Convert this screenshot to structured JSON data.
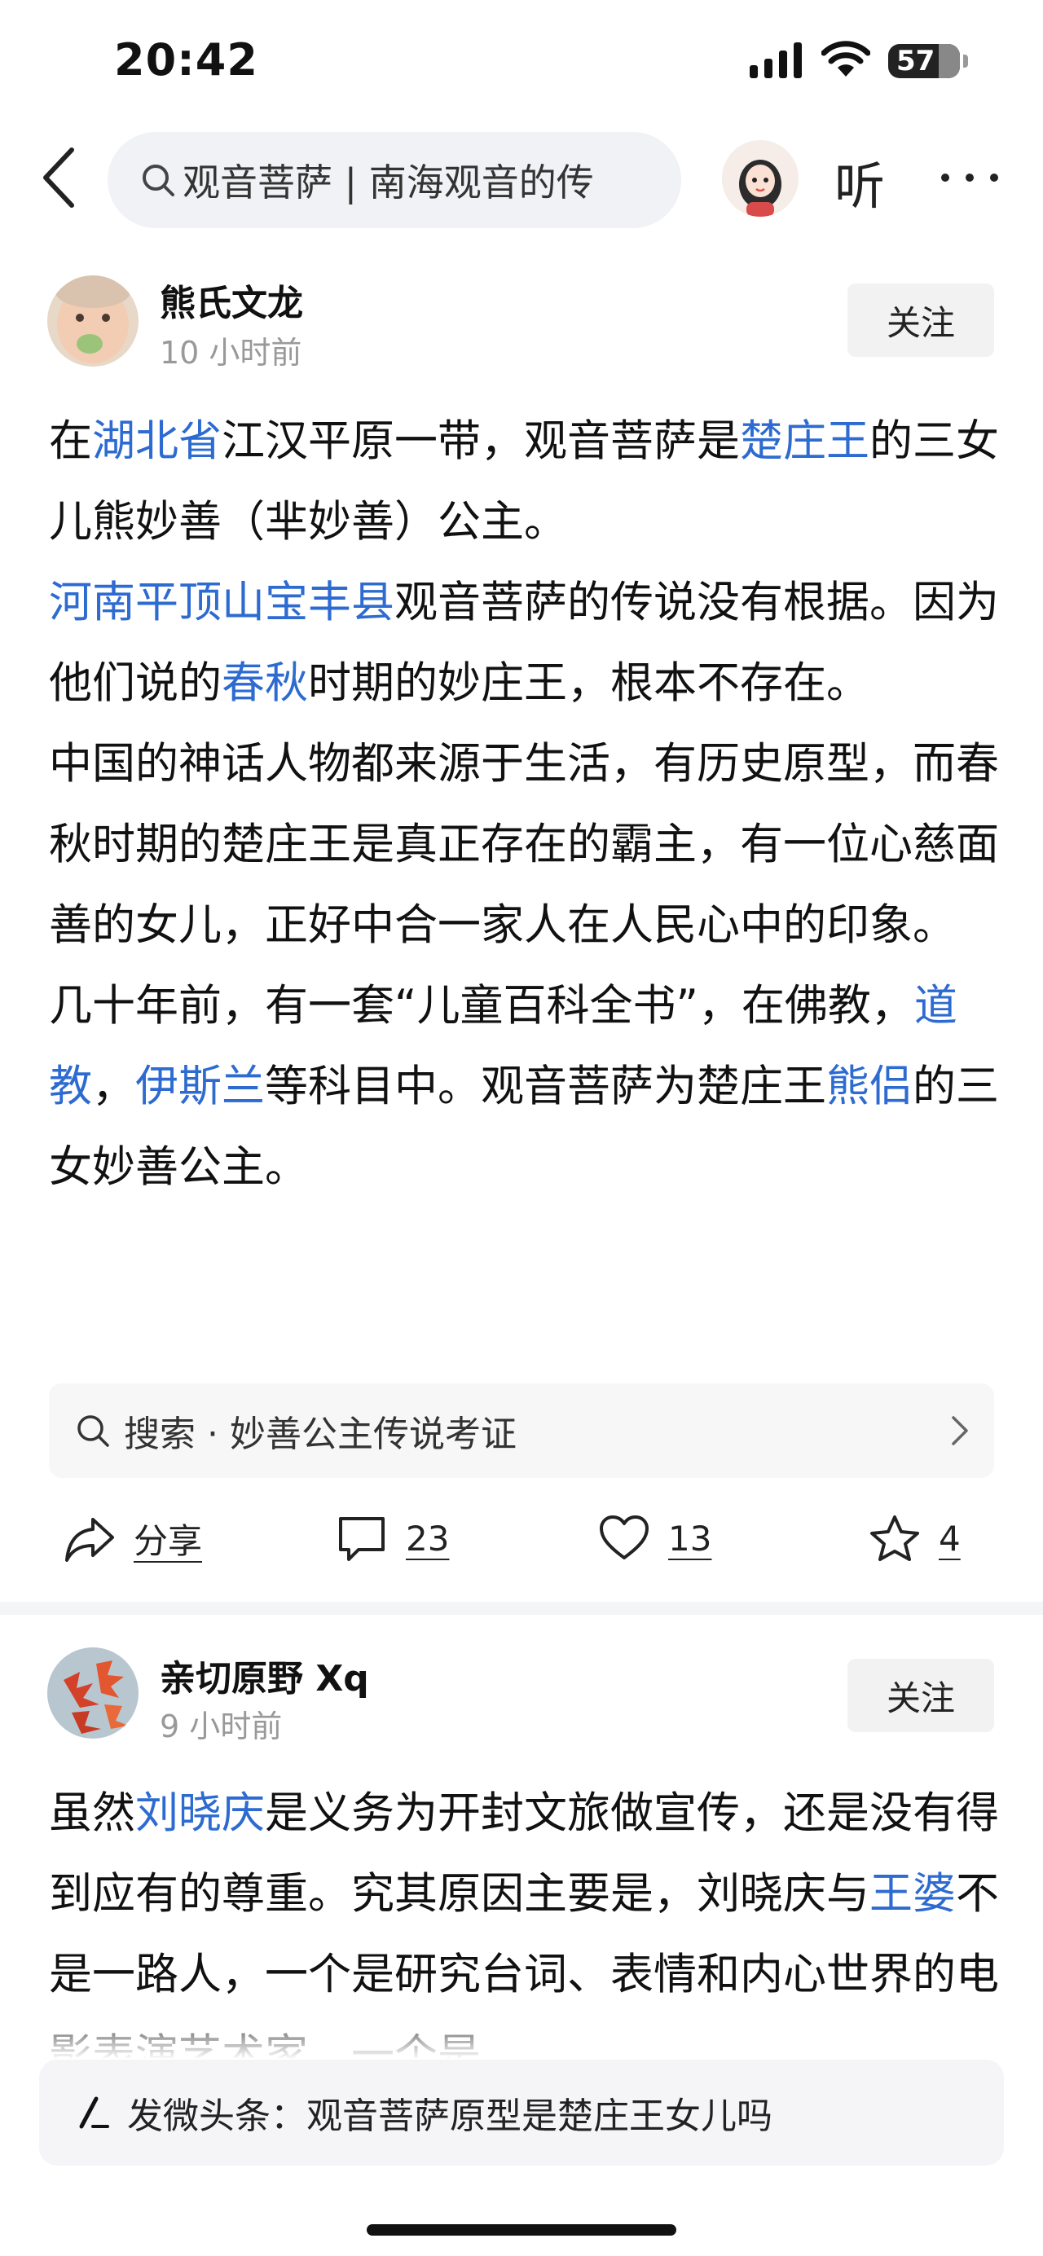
{
  "status_bar": {
    "time": "20:42",
    "battery": "57"
  },
  "nav": {
    "search_text": "观音菩萨 | 南海观音的传",
    "listen_label": "听"
  },
  "posts": [
    {
      "author": "熊氏文龙",
      "time": "10 小时前",
      "follow_label": "关注",
      "paragraphs": [
        [
          {
            "t": "在"
          },
          {
            "t": "湖北省",
            "link": true
          },
          {
            "t": "江汉平原一带，观音菩萨是"
          },
          {
            "t": "楚庄王",
            "link": true
          },
          {
            "t": "的三女儿熊妙善（芈妙善）公主。"
          }
        ],
        [
          {
            "t": "河南平顶山宝丰县",
            "link": true
          },
          {
            "t": "观音菩萨的传说没有根据。因为他们说的"
          },
          {
            "t": "春秋",
            "link": true
          },
          {
            "t": "时期的妙庄王，根本不存在。"
          }
        ],
        [
          {
            "t": "中国的神话人物都来源于生活，有历史原型，而春秋时期的楚庄王是真正存在的霸主，有一位心慈面善的女儿，正好中合一家人在人民心中的印象。"
          }
        ],
        [
          {
            "t": "几十年前，有一套“儿童百科全书”，在佛教，"
          },
          {
            "t": "道教",
            "link": true
          },
          {
            "t": "，"
          },
          {
            "t": "伊斯兰",
            "link": true
          },
          {
            "t": "等科目中。观音菩萨为楚庄王"
          },
          {
            "t": "熊侣",
            "link": true
          },
          {
            "t": "的三女妙善公主。"
          }
        ]
      ],
      "search_suggest": "搜索 · 妙善公主传说考证",
      "actions": {
        "share": "分享",
        "comments": "23",
        "likes": "13",
        "favorites": "4"
      }
    },
    {
      "author": "亲切原野 Xq",
      "time": "9 小时前",
      "follow_label": "关注",
      "paragraphs": [
        [
          {
            "t": "虽然"
          },
          {
            "t": "刘晓庆",
            "link": true
          },
          {
            "t": "是义务为开封文旅做宣传，还是没有得到应有的尊重。究其原因主要是，刘晓庆与"
          },
          {
            "t": "王婆",
            "link": true
          },
          {
            "t": "不是一路人，一个是研究台词、表情和内心世界的电影表演艺术家，一个是"
          }
        ]
      ]
    }
  ],
  "draft_bar": {
    "label": "发微头条：观音菩萨原型是楚庄王女儿吗"
  },
  "colors": {
    "link": "#2d6bd1",
    "muted": "#999999",
    "button_bg": "#f2f2f2"
  }
}
